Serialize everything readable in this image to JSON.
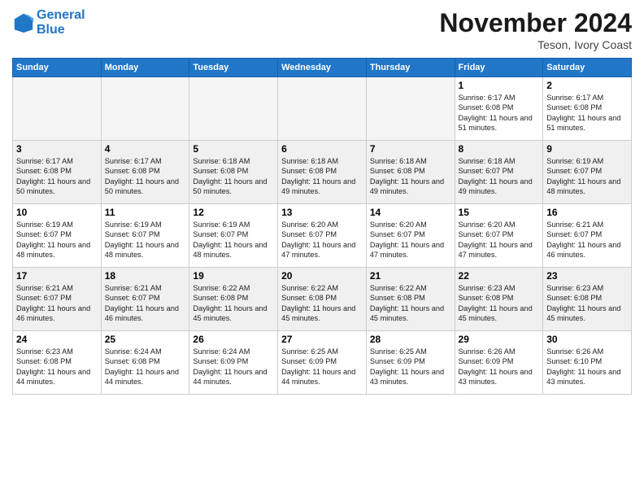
{
  "header": {
    "logo_line1": "General",
    "logo_line2": "Blue",
    "month_title": "November 2024",
    "location": "Teson, Ivory Coast"
  },
  "weekdays": [
    "Sunday",
    "Monday",
    "Tuesday",
    "Wednesday",
    "Thursday",
    "Friday",
    "Saturday"
  ],
  "weeks": [
    [
      {
        "day": "",
        "info": "",
        "empty": true
      },
      {
        "day": "",
        "info": "",
        "empty": true
      },
      {
        "day": "",
        "info": "",
        "empty": true
      },
      {
        "day": "",
        "info": "",
        "empty": true
      },
      {
        "day": "",
        "info": "",
        "empty": true
      },
      {
        "day": "1",
        "info": "Sunrise: 6:17 AM\nSunset: 6:08 PM\nDaylight: 11 hours\nand 51 minutes."
      },
      {
        "day": "2",
        "info": "Sunrise: 6:17 AM\nSunset: 6:08 PM\nDaylight: 11 hours\nand 51 minutes."
      }
    ],
    [
      {
        "day": "3",
        "info": "Sunrise: 6:17 AM\nSunset: 6:08 PM\nDaylight: 11 hours\nand 50 minutes."
      },
      {
        "day": "4",
        "info": "Sunrise: 6:17 AM\nSunset: 6:08 PM\nDaylight: 11 hours\nand 50 minutes."
      },
      {
        "day": "5",
        "info": "Sunrise: 6:18 AM\nSunset: 6:08 PM\nDaylight: 11 hours\nand 50 minutes."
      },
      {
        "day": "6",
        "info": "Sunrise: 6:18 AM\nSunset: 6:08 PM\nDaylight: 11 hours\nand 49 minutes."
      },
      {
        "day": "7",
        "info": "Sunrise: 6:18 AM\nSunset: 6:08 PM\nDaylight: 11 hours\nand 49 minutes."
      },
      {
        "day": "8",
        "info": "Sunrise: 6:18 AM\nSunset: 6:07 PM\nDaylight: 11 hours\nand 49 minutes."
      },
      {
        "day": "9",
        "info": "Sunrise: 6:19 AM\nSunset: 6:07 PM\nDaylight: 11 hours\nand 48 minutes."
      }
    ],
    [
      {
        "day": "10",
        "info": "Sunrise: 6:19 AM\nSunset: 6:07 PM\nDaylight: 11 hours\nand 48 minutes."
      },
      {
        "day": "11",
        "info": "Sunrise: 6:19 AM\nSunset: 6:07 PM\nDaylight: 11 hours\nand 48 minutes."
      },
      {
        "day": "12",
        "info": "Sunrise: 6:19 AM\nSunset: 6:07 PM\nDaylight: 11 hours\nand 48 minutes."
      },
      {
        "day": "13",
        "info": "Sunrise: 6:20 AM\nSunset: 6:07 PM\nDaylight: 11 hours\nand 47 minutes."
      },
      {
        "day": "14",
        "info": "Sunrise: 6:20 AM\nSunset: 6:07 PM\nDaylight: 11 hours\nand 47 minutes."
      },
      {
        "day": "15",
        "info": "Sunrise: 6:20 AM\nSunset: 6:07 PM\nDaylight: 11 hours\nand 47 minutes."
      },
      {
        "day": "16",
        "info": "Sunrise: 6:21 AM\nSunset: 6:07 PM\nDaylight: 11 hours\nand 46 minutes."
      }
    ],
    [
      {
        "day": "17",
        "info": "Sunrise: 6:21 AM\nSunset: 6:07 PM\nDaylight: 11 hours\nand 46 minutes."
      },
      {
        "day": "18",
        "info": "Sunrise: 6:21 AM\nSunset: 6:07 PM\nDaylight: 11 hours\nand 46 minutes."
      },
      {
        "day": "19",
        "info": "Sunrise: 6:22 AM\nSunset: 6:08 PM\nDaylight: 11 hours\nand 45 minutes."
      },
      {
        "day": "20",
        "info": "Sunrise: 6:22 AM\nSunset: 6:08 PM\nDaylight: 11 hours\nand 45 minutes."
      },
      {
        "day": "21",
        "info": "Sunrise: 6:22 AM\nSunset: 6:08 PM\nDaylight: 11 hours\nand 45 minutes."
      },
      {
        "day": "22",
        "info": "Sunrise: 6:23 AM\nSunset: 6:08 PM\nDaylight: 11 hours\nand 45 minutes."
      },
      {
        "day": "23",
        "info": "Sunrise: 6:23 AM\nSunset: 6:08 PM\nDaylight: 11 hours\nand 45 minutes."
      }
    ],
    [
      {
        "day": "24",
        "info": "Sunrise: 6:23 AM\nSunset: 6:08 PM\nDaylight: 11 hours\nand 44 minutes."
      },
      {
        "day": "25",
        "info": "Sunrise: 6:24 AM\nSunset: 6:08 PM\nDaylight: 11 hours\nand 44 minutes."
      },
      {
        "day": "26",
        "info": "Sunrise: 6:24 AM\nSunset: 6:09 PM\nDaylight: 11 hours\nand 44 minutes."
      },
      {
        "day": "27",
        "info": "Sunrise: 6:25 AM\nSunset: 6:09 PM\nDaylight: 11 hours\nand 44 minutes."
      },
      {
        "day": "28",
        "info": "Sunrise: 6:25 AM\nSunset: 6:09 PM\nDaylight: 11 hours\nand 43 minutes."
      },
      {
        "day": "29",
        "info": "Sunrise: 6:26 AM\nSunset: 6:09 PM\nDaylight: 11 hours\nand 43 minutes."
      },
      {
        "day": "30",
        "info": "Sunrise: 6:26 AM\nSunset: 6:10 PM\nDaylight: 11 hours\nand 43 minutes."
      }
    ]
  ]
}
